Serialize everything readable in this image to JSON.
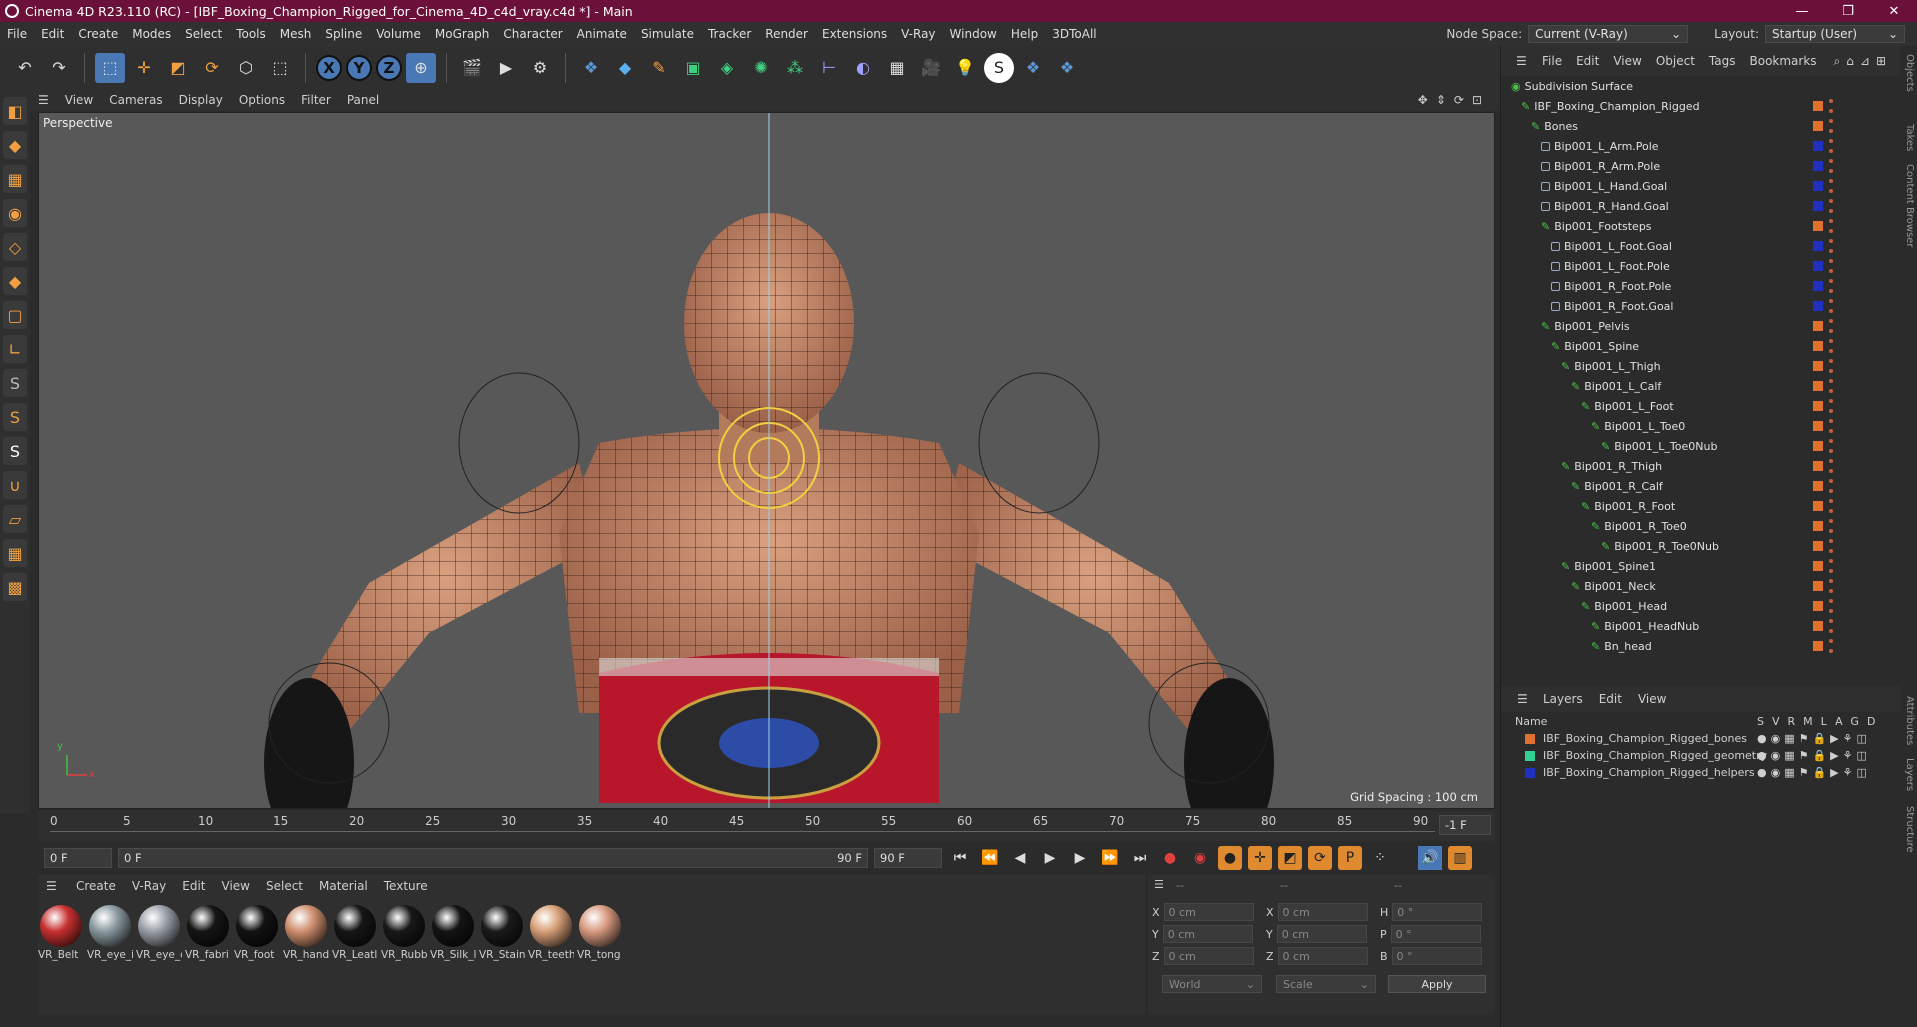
{
  "window": {
    "title": "Cinema 4D R23.110 (RC) - [IBF_Boxing_Champion_Rigged_for_Cinema_4D_c4d_vray.c4d *] - Main",
    "minimize": "—",
    "maximize": "❐",
    "close": "✕"
  },
  "menu": {
    "items": [
      "File",
      "Edit",
      "Create",
      "Modes",
      "Select",
      "Tools",
      "Mesh",
      "Spline",
      "Volume",
      "MoGraph",
      "Character",
      "Animate",
      "Simulate",
      "Tracker",
      "Render",
      "Extensions",
      "V-Ray",
      "Window",
      "Help",
      "3DToAll"
    ],
    "node_space_label": "Node Space:",
    "node_space_value": "Current (V-Ray)",
    "layout_label": "Layout:",
    "layout_value": "Startup (User)"
  },
  "toolbar": {
    "axis_x": "X",
    "axis_y": "Y",
    "axis_z": "Z"
  },
  "viewport": {
    "menu": [
      "View",
      "Cameras",
      "Display",
      "Options",
      "Filter",
      "Panel"
    ],
    "label": "Perspective",
    "grid_spacing": "Grid Spacing : 100 cm",
    "axis_y": "y",
    "axis_x": "x"
  },
  "timeline": {
    "ticks": [
      "0",
      "5",
      "10",
      "15",
      "20",
      "25",
      "30",
      "35",
      "40",
      "45",
      "50",
      "55",
      "60",
      "65",
      "70",
      "75",
      "80",
      "85",
      "90"
    ],
    "end_field": "-1 F"
  },
  "transport": {
    "start": "0 F",
    "current": "0 F",
    "range_end": "90 F",
    "end": "90 F"
  },
  "materials": {
    "menu": [
      "Create",
      "V-Ray",
      "Edit",
      "View",
      "Select",
      "Material",
      "Texture"
    ],
    "items": [
      {
        "label": "VR_Belt",
        "color": "#c83030"
      },
      {
        "label": "VR_eye_i",
        "color": "#8a9aa0"
      },
      {
        "label": "VR_eye_c",
        "color": "#9aa0a8"
      },
      {
        "label": "VR_fabri",
        "color": "#151515"
      },
      {
        "label": "VR_foot",
        "color": "#121212"
      },
      {
        "label": "VR_hand",
        "color": "#d09070"
      },
      {
        "label": "VR_Leatl",
        "color": "#161616"
      },
      {
        "label": "VR_Rubb",
        "color": "#181818"
      },
      {
        "label": "VR_Silk_l",
        "color": "#141414"
      },
      {
        "label": "VR_Stain",
        "color": "#1a1a1a"
      },
      {
        "label": "VR_teeth",
        "color": "#d8a078"
      },
      {
        "label": "VR_tong",
        "color": "#d89a80"
      }
    ]
  },
  "coords": {
    "headers": [
      "--",
      "--",
      "--"
    ],
    "x": "X",
    "y": "Y",
    "z": "Z",
    "x_val": "0 cm",
    "y_val": "0 cm",
    "z_val": "0 cm",
    "x2": "X",
    "y2": "Y",
    "z2": "Z",
    "x2_val": "0 cm",
    "y2_val": "0 cm",
    "z2_val": "0 cm",
    "h": "H",
    "p": "P",
    "b": "B",
    "h_val": "0 °",
    "p_val": "0 °",
    "b_val": "0 °",
    "world": "World",
    "scale": "Scale",
    "apply": "Apply"
  },
  "objects": {
    "menu": [
      "File",
      "Edit",
      "View",
      "Object",
      "Tags",
      "Bookmarks"
    ],
    "rows": [
      {
        "label": "Subdivision Surface",
        "indent": 0,
        "color": "none"
      },
      {
        "label": "IBF_Boxing_Champion_Rigged",
        "indent": 1,
        "color": "#e07030"
      },
      {
        "label": "Bones",
        "indent": 2,
        "color": "#e07030"
      },
      {
        "label": "Bip001_L_Arm.Pole",
        "indent": 3,
        "color": "#2030c0"
      },
      {
        "label": "Bip001_R_Arm.Pole",
        "indent": 3,
        "color": "#2030c0"
      },
      {
        "label": "Bip001_L_Hand.Goal",
        "indent": 3,
        "color": "#2030c0"
      },
      {
        "label": "Bip001_R_Hand.Goal",
        "indent": 3,
        "color": "#2030c0"
      },
      {
        "label": "Bip001_Footsteps",
        "indent": 3,
        "color": "#e07030"
      },
      {
        "label": "Bip001_L_Foot.Goal",
        "indent": 4,
        "color": "#2030c0"
      },
      {
        "label": "Bip001_L_Foot.Pole",
        "indent": 4,
        "color": "#2030c0"
      },
      {
        "label": "Bip001_R_Foot.Pole",
        "indent": 4,
        "color": "#2030c0"
      },
      {
        "label": "Bip001_R_Foot.Goal",
        "indent": 4,
        "color": "#2030c0"
      },
      {
        "label": "Bip001_Pelvis",
        "indent": 3,
        "color": "#e07030"
      },
      {
        "label": "Bip001_Spine",
        "indent": 4,
        "color": "#e07030"
      },
      {
        "label": "Bip001_L_Thigh",
        "indent": 5,
        "color": "#e07030"
      },
      {
        "label": "Bip001_L_Calf",
        "indent": 6,
        "color": "#e07030"
      },
      {
        "label": "Bip001_L_Foot",
        "indent": 7,
        "color": "#e07030"
      },
      {
        "label": "Bip001_L_Toe0",
        "indent": 8,
        "color": "#e07030"
      },
      {
        "label": "Bip001_L_Toe0Nub",
        "indent": 9,
        "color": "#e07030"
      },
      {
        "label": "Bip001_R_Thigh",
        "indent": 5,
        "color": "#e07030"
      },
      {
        "label": "Bip001_R_Calf",
        "indent": 6,
        "color": "#e07030"
      },
      {
        "label": "Bip001_R_Foot",
        "indent": 7,
        "color": "#e07030"
      },
      {
        "label": "Bip001_R_Toe0",
        "indent": 8,
        "color": "#e07030"
      },
      {
        "label": "Bip001_R_Toe0Nub",
        "indent": 9,
        "color": "#e07030"
      },
      {
        "label": "Bip001_Spine1",
        "indent": 5,
        "color": "#e07030"
      },
      {
        "label": "Bip001_Neck",
        "indent": 6,
        "color": "#e07030"
      },
      {
        "label": "Bip001_Head",
        "indent": 7,
        "color": "#e07030"
      },
      {
        "label": "Bip001_HeadNub",
        "indent": 8,
        "color": "#e07030"
      },
      {
        "label": "Bn_head",
        "indent": 8,
        "color": "#e07030"
      }
    ]
  },
  "layers": {
    "menu": [
      "Layers",
      "Edit",
      "View"
    ],
    "name_header": "Name",
    "cols": [
      "S",
      "V",
      "R",
      "M",
      "L",
      "A",
      "G",
      "D"
    ],
    "rows": [
      {
        "label": "IBF_Boxing_Champion_Rigged_bones",
        "color": "#e07030"
      },
      {
        "label": "IBF_Boxing_Champion_Rigged_geometry",
        "color": "#30d090"
      },
      {
        "label": "IBF_Boxing_Champion_Rigged_helpers",
        "color": "#2030c0"
      }
    ]
  },
  "side_tabs": [
    "Objects",
    "Takes",
    "Content Browser",
    "Attributes",
    "Layers",
    "Structure"
  ]
}
